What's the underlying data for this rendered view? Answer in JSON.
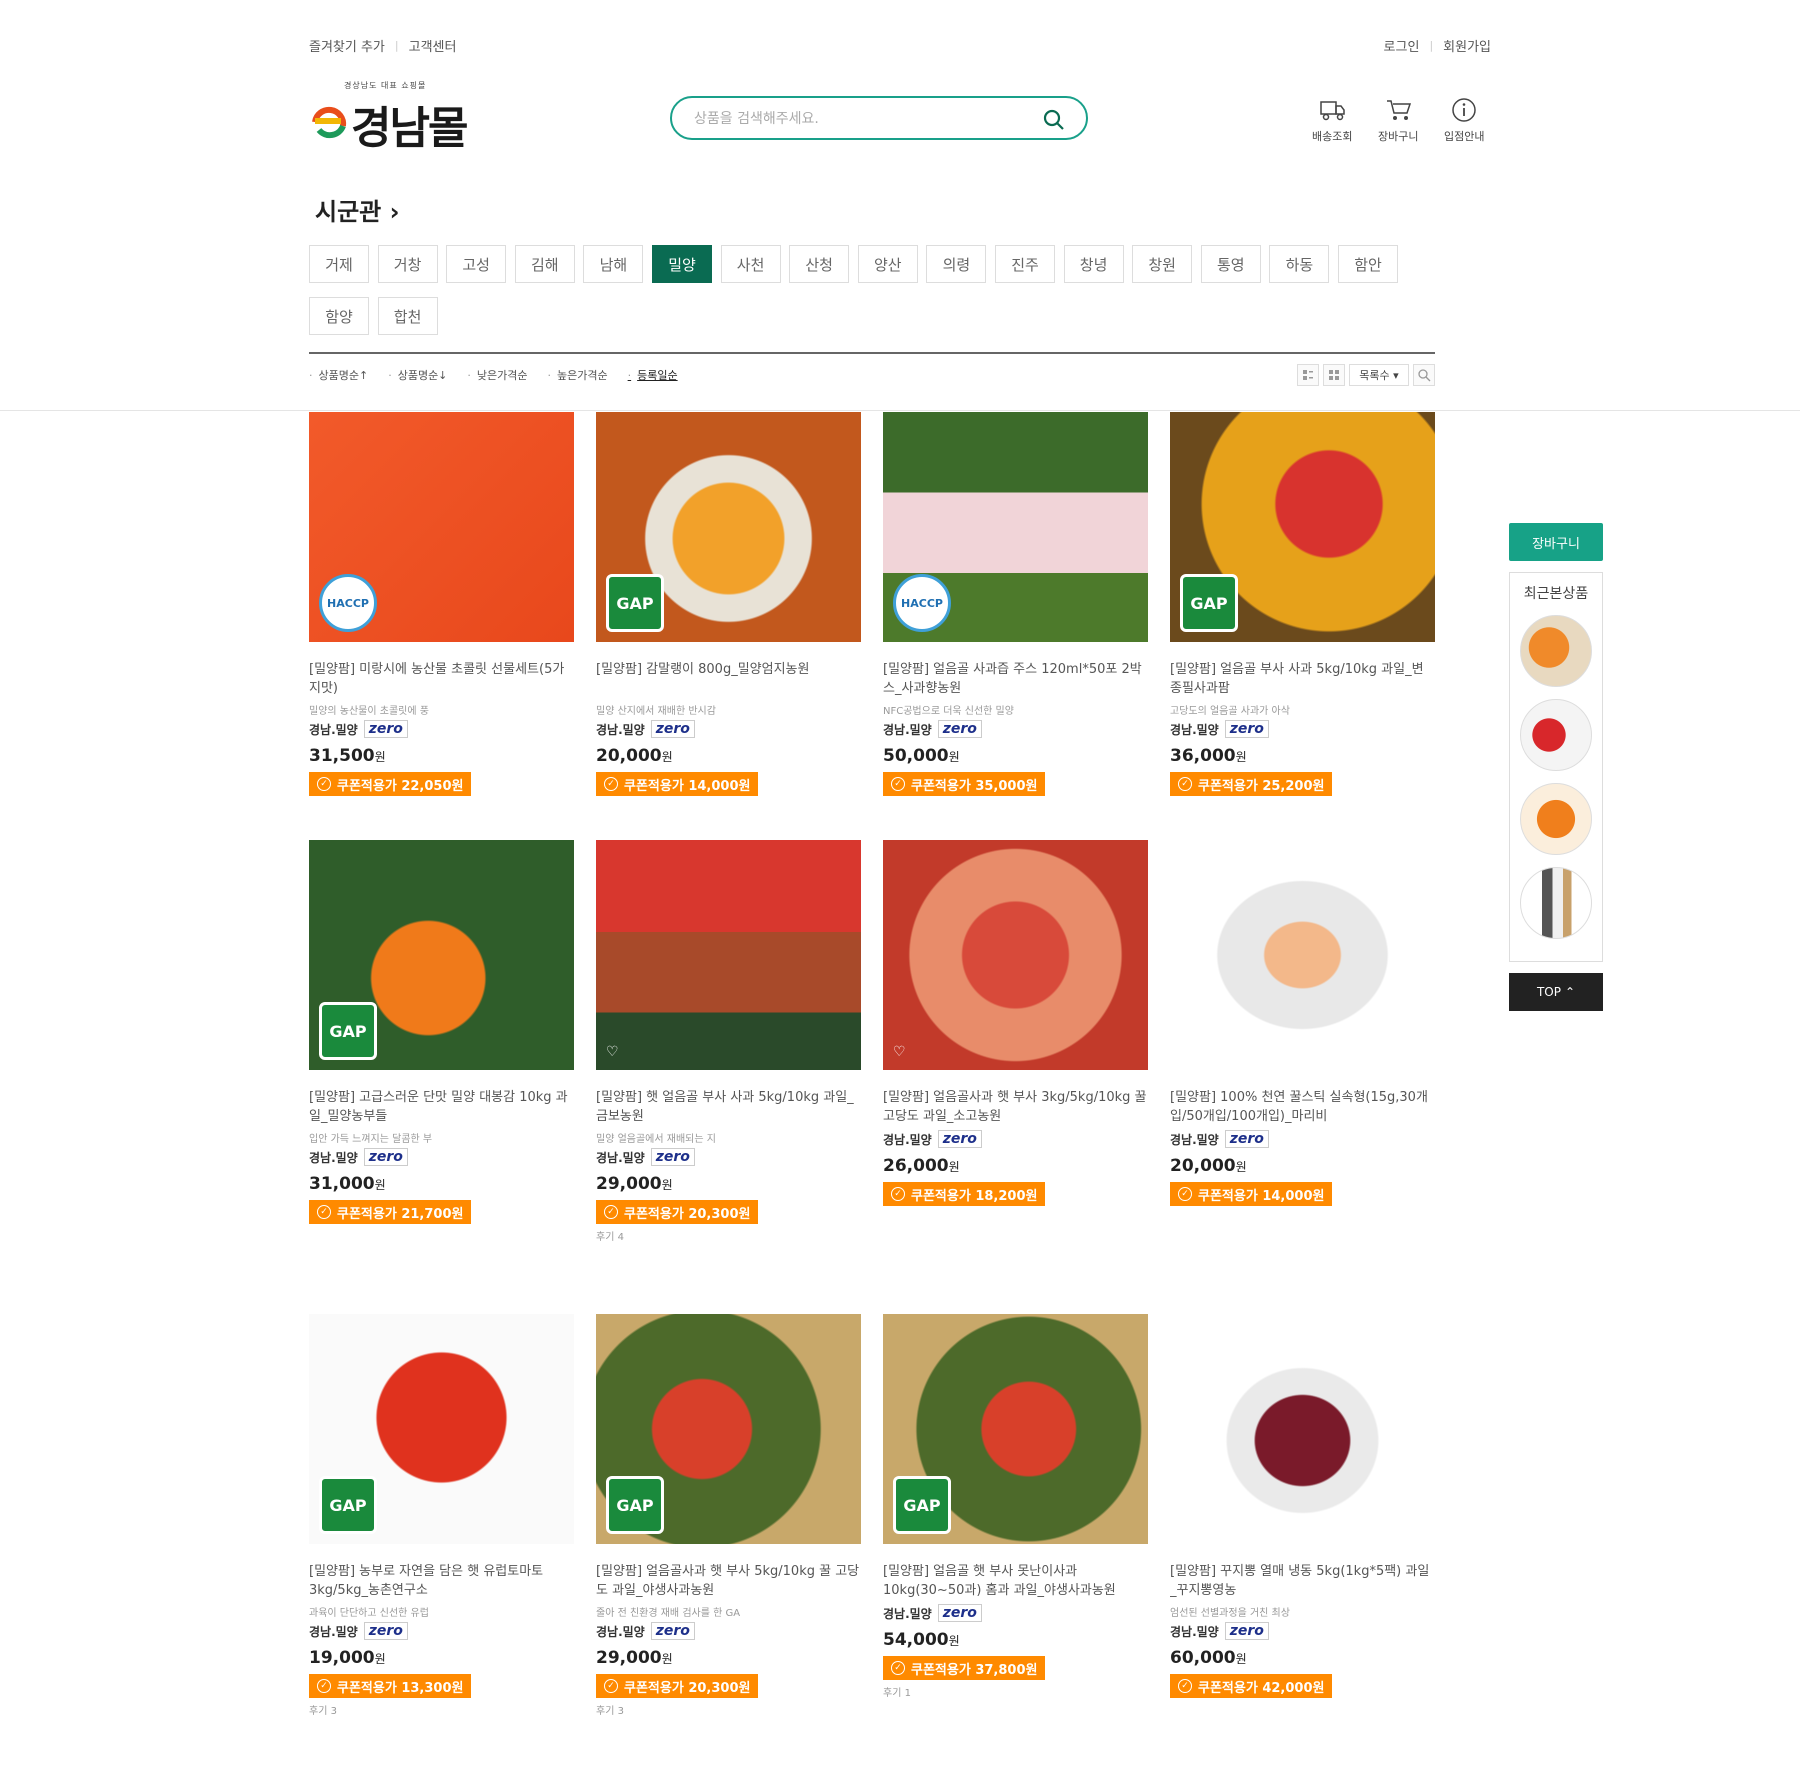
{
  "topbar": {
    "bookmark": "즐겨찾기 추가",
    "customer_center": "고객센터",
    "login": "로그인",
    "signup": "회원가입"
  },
  "logo": {
    "tagline": "경상남도 대표 쇼핑몰",
    "wordmark": "경남몰",
    "letter": "e"
  },
  "search": {
    "placeholder": "상품을 검색해주세요."
  },
  "quick_links": {
    "delivery": "배송조회",
    "cart": "장바구니",
    "store_info": "입점안내"
  },
  "section_title": "시군관 ›",
  "regions": [
    "거제",
    "거창",
    "고성",
    "김해",
    "남해",
    "밀양",
    "사천",
    "산청",
    "양산",
    "의령",
    "진주",
    "창녕",
    "창원",
    "통영",
    "하동",
    "함안",
    "함양",
    "합천"
  ],
  "active_region": "밀양",
  "sort_options": [
    "상품명순↑",
    "상품명순↓",
    "낮은가격순",
    "높은가격순",
    "등록일순"
  ],
  "view_select": "목록수",
  "products": [
    {
      "name": "[밀양팜] 미랑시에 농산물 초콜릿 선물세트(5가지맛)",
      "desc": "밀양의 농산물이 초콜릿에 풍",
      "seller": "경남.밀양",
      "zero": "zero",
      "price": "31,500",
      "won": "원",
      "coupon": "쿠폰적용가 22,050원",
      "review": "",
      "badge": "HACCP"
    },
    {
      "name": "[밀양팜] 감말랭이 800g_밀양엄지농원",
      "desc": "밀양 산지에서 재배한 반시감",
      "seller": "경남.밀양",
      "zero": "zero",
      "price": "20,000",
      "won": "원",
      "coupon": "쿠폰적용가 14,000원",
      "review": "",
      "badge": "GAP"
    },
    {
      "name": "[밀양팜] 얼음골 사과즙 주스 120ml*50포 2박스_사과향농원",
      "desc": "NFC공법으로 더욱 신선한 밀양",
      "seller": "경남.밀양",
      "zero": "zero",
      "price": "50,000",
      "won": "원",
      "coupon": "쿠폰적용가 35,000원",
      "review": "",
      "badge": "HACCP"
    },
    {
      "name": "[밀양팜] 얼음골 부사 사과 5kg/10kg 과일_변종필사과팜",
      "desc": "고당도의 얼음골 사과가 아삭",
      "seller": "경남.밀양",
      "zero": "zero",
      "price": "36,000",
      "won": "원",
      "coupon": "쿠폰적용가 25,200원",
      "review": "",
      "badge": "GAP"
    },
    {
      "name": "[밀양팜] 고급스러운 단맛 밀양 대봉감 10kg 과일_밀양농부들",
      "desc": "입안 가득 느껴지는 달콤한 부",
      "seller": "경남.밀양",
      "zero": "zero",
      "price": "31,000",
      "won": "원",
      "coupon": "쿠폰적용가 21,700원",
      "review": "",
      "badge": "GAP"
    },
    {
      "name": "[밀양팜] 햇 얼음골 부사 사과 5kg/10kg 과일_금보농원",
      "desc": "밀양 얼음골에서 재배되는 지",
      "seller": "경남.밀양",
      "zero": "zero",
      "price": "29,000",
      "won": "원",
      "coupon": "쿠폰적용가 20,300원",
      "review": "후기 4",
      "badge": ""
    },
    {
      "name": "[밀양팜] 얼음골사과 햇 부사 3kg/5kg/10kg 꿀 고당도 과일_소고농원",
      "desc": "",
      "seller": "경남.밀양",
      "zero": "zero",
      "price": "26,000",
      "won": "원",
      "coupon": "쿠폰적용가 18,200원",
      "review": "",
      "badge": ""
    },
    {
      "name": "[밀양팜] 100% 천연 꿀스틱 실속형(15g,30개입/50개입/100개입)_마리비",
      "desc": "",
      "seller": "경남.밀양",
      "zero": "zero",
      "price": "20,000",
      "won": "원",
      "coupon": "쿠폰적용가 14,000원",
      "review": "",
      "badge": ""
    },
    {
      "name": "[밀양팜] 농부로 자연을 담은 햇 유럽토마토 3kg/5kg_농촌연구소",
      "desc": "과육이 단단하고 신선한 유럽",
      "seller": "경남.밀양",
      "zero": "zero",
      "price": "19,000",
      "won": "원",
      "coupon": "쿠폰적용가 13,300원",
      "review": "후기 3",
      "badge": "GAP"
    },
    {
      "name": "[밀양팜] 얼음골사과 햇 부사 5kg/10kg 꿀 고당도 과일_야생사과농원",
      "desc": "줄아 전 친환경 재배 검사를 한 GA",
      "seller": "경남.밀양",
      "zero": "zero",
      "price": "29,000",
      "won": "원",
      "coupon": "쿠폰적용가 20,300원",
      "review": "후기 3",
      "badge": "GAP"
    },
    {
      "name": "[밀양팜] 얼음골 햇 부사 못난이사과 10kg(30~50과) 홈과 과일_야생사과농원",
      "desc": "",
      "seller": "경남.밀양",
      "zero": "zero",
      "price": "54,000",
      "won": "원",
      "coupon": "쿠폰적용가 37,800원",
      "review": "후기 1",
      "badge": "GAP"
    },
    {
      "name": "[밀양팜] 꾸지뽕 열매 냉동 5kg(1kg*5팩) 과일_꾸지뽕영농",
      "desc": "엄선된 선별과정을 거친 최상",
      "seller": "경남.밀양",
      "zero": "zero",
      "price": "60,000",
      "won": "원",
      "coupon": "쿠폰적용가 42,000원",
      "review": "",
      "badge": ""
    }
  ],
  "sidebar": {
    "cart": "장바구니",
    "recent_title": "최근본상품",
    "top": "TOP"
  },
  "colors": {
    "brand_green": "#0a6b52",
    "accent_teal": "#17a287",
    "coupon_orange": "#ff8a00"
  }
}
